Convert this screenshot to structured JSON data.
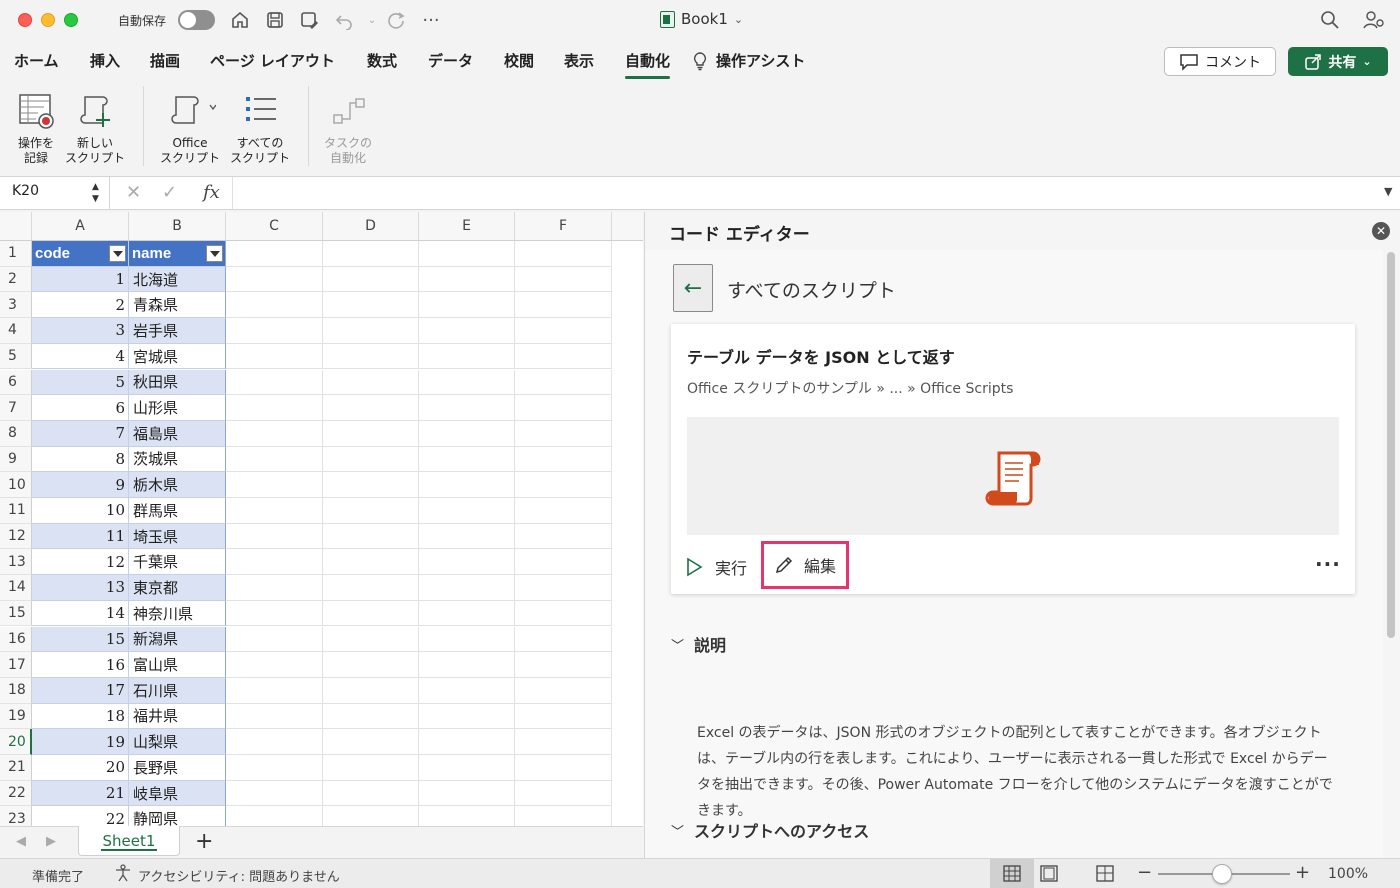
{
  "titlebar": {
    "autosave_label": "自動保存",
    "doc_title": "Book1",
    "more": "···"
  },
  "tabs": {
    "home": "ホーム",
    "insert": "挿入",
    "draw": "描画",
    "page_layout": "ページ レイアウト",
    "formulas": "数式",
    "data": "データ",
    "review": "校閲",
    "view": "表示",
    "automate": "自動化",
    "tell_me": "操作アシスト",
    "comment": "コメント",
    "share": "共有"
  },
  "ribbon": {
    "record_line1": "操作を",
    "record_line2": "記録",
    "new_line1": "新しい",
    "new_line2": "スクリプト",
    "office_line1": "Office",
    "office_line2": "スクリプト",
    "all_line1": "すべての",
    "all_line2": "スクリプト",
    "task_line1": "タスクの",
    "task_line2": "自動化"
  },
  "formula_bar": {
    "name_box": "K20",
    "fx": "fx"
  },
  "grid": {
    "columns": [
      "A",
      "B",
      "C",
      "D",
      "E",
      "F"
    ],
    "header_code": "code",
    "header_name": "name",
    "row_numbers": [
      "1",
      "2",
      "3",
      "4",
      "5",
      "6",
      "7",
      "8",
      "9",
      "10",
      "11",
      "12",
      "13",
      "14",
      "15",
      "16",
      "17",
      "18",
      "19",
      "20",
      "21",
      "22",
      "23"
    ],
    "codes": [
      "1",
      "2",
      "3",
      "4",
      "5",
      "6",
      "7",
      "8",
      "9",
      "10",
      "11",
      "12",
      "13",
      "14",
      "15",
      "16",
      "17",
      "18",
      "19",
      "20",
      "21",
      "22"
    ],
    "names": [
      "北海道",
      "青森県",
      "岩手県",
      "宮城県",
      "秋田県",
      "山形県",
      "福島県",
      "茨城県",
      "栃木県",
      "群馬県",
      "埼玉県",
      "千葉県",
      "東京都",
      "神奈川県",
      "新潟県",
      "富山県",
      "石川県",
      "福井県",
      "山梨県",
      "長野県",
      "岐阜県",
      "静岡県"
    ],
    "selected_row": "20"
  },
  "sheets": {
    "active": "Sheet1",
    "add": "+"
  },
  "status": {
    "ready": "準備完了",
    "accessibility": "アクセシビリティ: 問題ありません",
    "zoom_minus": "−",
    "zoom_plus": "+",
    "zoom_level": "100%"
  },
  "code_editor": {
    "title": "コード エディター",
    "back_label": "すべてのスクリプト",
    "script_title": "テーブル データを JSON として返す",
    "script_path": "Office スクリプトのサンプル » ... » Office Scripts",
    "run_label": "実行",
    "edit_label": "編集",
    "more": "···",
    "description_heading": "説明",
    "description_text": "Excel の表データは、JSON 形式のオブジェクトの配列として表すことができます。各オブジェクトは、テーブル内の行を表します。これにより、ユーザーに表示される一貫した形式で Excel からデータを抽出できます。その後、Power Automate フローを介して他のシステムにデータを渡すことができます。",
    "access_heading": "スクリプトへのアクセス"
  },
  "colors": {
    "accent": "#1e7145",
    "table_header": "#4472c4",
    "table_band": "#dae2f3",
    "highlight": "#e8346c"
  }
}
